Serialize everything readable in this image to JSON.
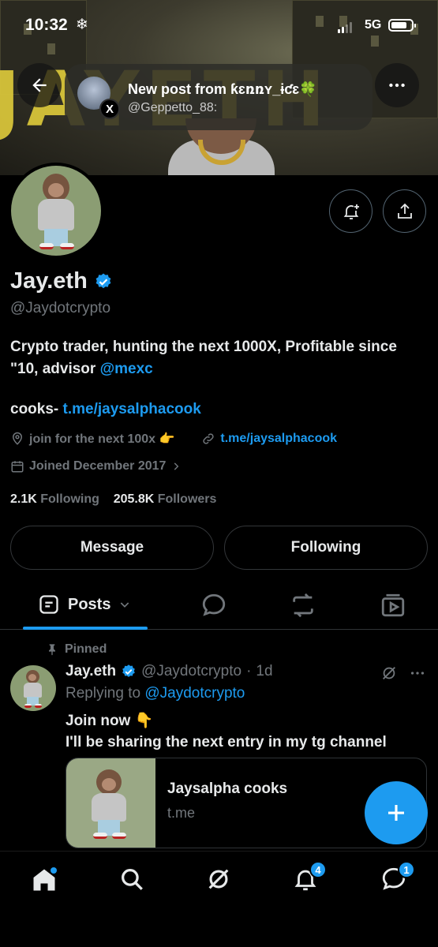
{
  "status_bar": {
    "time": "10:32",
    "extra_icon": "snowflake-icon",
    "network": "5G"
  },
  "notification": {
    "title": "New post from ƙɛռռʏ_ɨƈɛ🍀",
    "subtitle": "@Geppetto_88:",
    "badge_letter": "X"
  },
  "profile": {
    "name": "Jay.eth",
    "handle": "@Jaydotcrypto",
    "bio_text": "Crypto trader, hunting the next 1000X, Profitable since \"10, advisor ",
    "bio_mention": "@mexc",
    "cooks_label": "cooks- ",
    "cooks_link": "t.me/jaysalphacook",
    "location": "join for the next 100x 👉",
    "website": "t.me/jaysalphacook",
    "joined": "Joined December 2017",
    "following_count": "2.1K",
    "following_label": "Following",
    "followers_count": "205.8K",
    "followers_label": "Followers",
    "message_button": "Message",
    "following_button": "Following"
  },
  "tabs": {
    "posts_label": "Posts"
  },
  "post": {
    "pinned_label": "Pinned",
    "author": "Jay.eth",
    "handle": "@Jaydotcrypto",
    "dot": "·",
    "time": "1d",
    "replying_prefix": "Replying to ",
    "replying_handle": "@Jaydotcrypto",
    "line1": "Join now 👇",
    "line2": "I'll be sharing the next entry in my tg channel",
    "card_title": "Jaysalpha cooks",
    "card_domain": "t.me"
  },
  "bottom_nav": {
    "notifications_badge": "4",
    "messages_badge": "1"
  },
  "colors": {
    "accent": "#1d9bf0",
    "muted": "#71767b",
    "background": "#000000",
    "text": "#e7e9ea"
  }
}
